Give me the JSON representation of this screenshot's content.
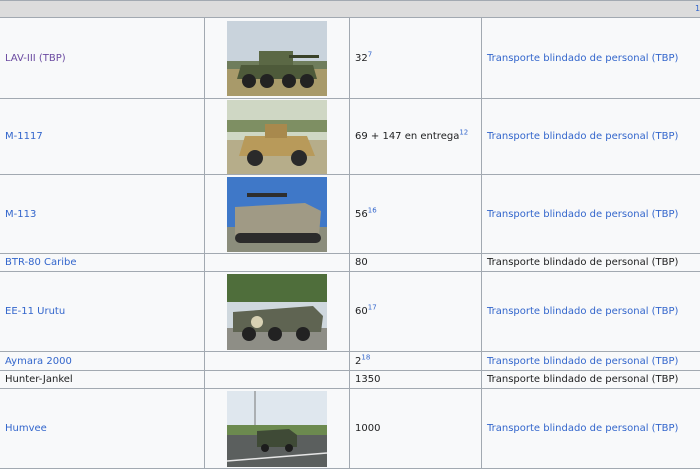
{
  "header": {
    "corner_mark": "1"
  },
  "rows": [
    {
      "name": "LAV-III (TBP)",
      "name_style": "visited",
      "image": "lav-iii-photo",
      "qty": "32",
      "ref": "7",
      "type": "Transporte blindado de personal (TBP)",
      "type_link": true
    },
    {
      "name": "M-1117",
      "name_style": "link",
      "image": "m1117-photo",
      "qty": "69 + 147 en entrega",
      "ref": "12",
      "type": "Transporte blindado de personal (TBP)",
      "type_link": true
    },
    {
      "name": "M-113",
      "name_style": "link",
      "image": "m113-photo",
      "qty": "56",
      "ref": "16",
      "type": "Transporte blindado de personal (TBP)",
      "type_link": true
    },
    {
      "name": "BTR-80 Caribe",
      "name_style": "link",
      "image": null,
      "qty": "80",
      "ref": "",
      "type": "Transporte blindado de personal (TBP)",
      "type_link": false
    },
    {
      "name": "EE-11 Urutu",
      "name_style": "link",
      "image": "ee11-photo",
      "qty": "60",
      "ref": "17",
      "type": "Transporte blindado de personal (TBP)",
      "type_link": true
    },
    {
      "name": "Aymara 2000",
      "name_style": "link",
      "image": null,
      "qty": "2",
      "ref": "18",
      "type": "Transporte blindado de personal (TBP)",
      "type_link": true
    },
    {
      "name": "Hunter-Jankel",
      "name_style": "plain",
      "image": null,
      "qty": "1350",
      "ref": "",
      "type": "Transporte blindado de personal (TBP)",
      "type_link": false
    },
    {
      "name": "Humvee",
      "name_style": "link",
      "image": "humvee-photo",
      "qty": "1000",
      "ref": "",
      "type": "Transporte blindado de personal (TBP)",
      "type_link": true
    }
  ]
}
